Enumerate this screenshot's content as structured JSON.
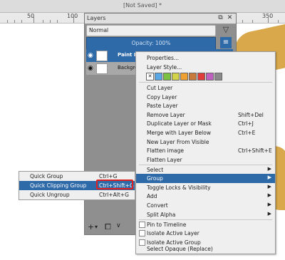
{
  "window": {
    "title": "[Not Saved]  *"
  },
  "ruler": {
    "labels": [
      "50",
      "100",
      "350"
    ]
  },
  "layers_docker": {
    "title": "Layers",
    "blend_mode": "Normal",
    "opacity": "Opacity:  100%",
    "layers": [
      {
        "name": "Paint La"
      },
      {
        "name": "Backgrou"
      }
    ]
  },
  "context_menu": {
    "items": [
      {
        "label": "Properties...",
        "shortcut": ""
      },
      {
        "label": "Layer Style...",
        "shortcut": ""
      },
      {
        "label": "Cut Layer",
        "shortcut": ""
      },
      {
        "label": "Copy Layer",
        "shortcut": ""
      },
      {
        "label": "Paste Layer",
        "shortcut": ""
      },
      {
        "label": "Remove Layer",
        "shortcut": "Shift+Del"
      },
      {
        "label": "Duplicate Layer or Mask",
        "shortcut": "Ctrl+J"
      },
      {
        "label": "Merge with Layer Below",
        "shortcut": "Ctrl+E"
      },
      {
        "label": "New Layer From Visible",
        "shortcut": ""
      },
      {
        "label": "Flatten image",
        "shortcut": "Ctrl+Shift+E"
      },
      {
        "label": "Flatten Layer",
        "shortcut": ""
      },
      {
        "label": "Select",
        "shortcut": ""
      },
      {
        "label": "Group",
        "shortcut": ""
      },
      {
        "label": "Toggle Locks & Visibility",
        "shortcut": ""
      },
      {
        "label": "Add",
        "shortcut": ""
      },
      {
        "label": "Convert",
        "shortcut": ""
      },
      {
        "label": "Split Alpha",
        "shortcut": ""
      },
      {
        "label": "Pin to Timeline",
        "shortcut": ""
      },
      {
        "label": "Isolate Active Layer",
        "shortcut": ""
      },
      {
        "label": "Isolate Active Group",
        "shortcut": ""
      },
      {
        "label": "Select Opaque (Replace)",
        "shortcut": ""
      }
    ],
    "color_labels": [
      "#ffffff",
      "#5aa9e6",
      "#7ac143",
      "#d3d34a",
      "#f0a030",
      "#c87a3a",
      "#e03c3c",
      "#c060c0",
      "#8a8a8a"
    ]
  },
  "group_submenu": {
    "items": [
      {
        "label": "Quick Group",
        "shortcut": "Ctrl+G"
      },
      {
        "label": "Quick Clipping Group",
        "shortcut": "Ctrl+Shift+G"
      },
      {
        "label": "Quick Ungroup",
        "shortcut": "Ctrl+Alt+G"
      }
    ]
  }
}
